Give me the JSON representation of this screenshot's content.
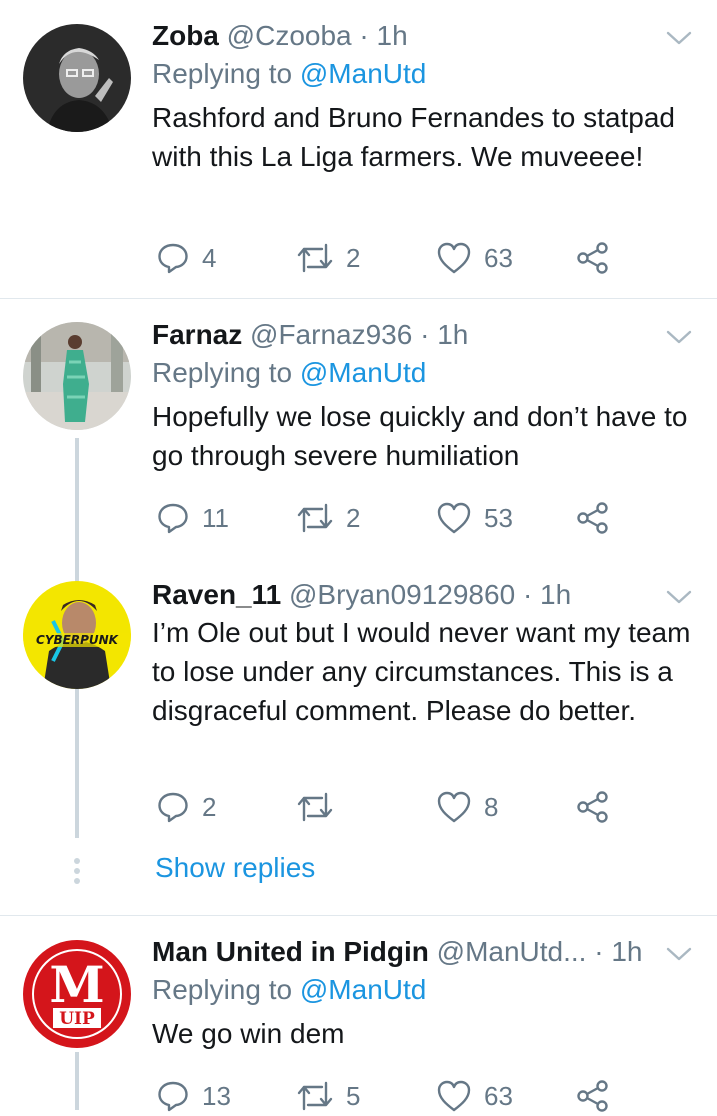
{
  "tweets": [
    {
      "name": "Zoba",
      "handle": "@Czooba",
      "dot": "·",
      "time": "1h",
      "replying_prefix": "Replying to ",
      "replying_to": "@ManUtd",
      "text": "Rashford and Bruno Fernandes to statpad with this La Liga farmers. We muveeee!",
      "replies": "4",
      "retweets": "2",
      "likes": "63"
    },
    {
      "name": "Farnaz",
      "handle": "@Farnaz936",
      "dot": "·",
      "time": "1h",
      "replying_prefix": "Replying to ",
      "replying_to": "@ManUtd",
      "text": "Hopefully we lose quickly and don’t have to go through severe humiliation",
      "replies": "11",
      "retweets": "2",
      "likes": "53"
    },
    {
      "name": "Raven_11",
      "handle": "@Bryan09129860",
      "dot": "·",
      "time": "1h",
      "text": "I’m Ole out but I would never want my team to lose under any circumstances. This is a disgraceful comment. Please do better.",
      "replies": "2",
      "retweets": "",
      "likes": "8",
      "avatar_text": "CYBERPUNK"
    },
    {
      "name": "Man United in Pidgin",
      "handle": "@ManUtd...",
      "dot": "·",
      "time": "1h",
      "replying_prefix": "Replying to ",
      "replying_to": "@ManUtd",
      "text": "We go win dem",
      "replies": "13",
      "retweets": "5",
      "likes": "63",
      "avatar_letter": "M",
      "avatar_text": "UIP"
    }
  ],
  "show_replies": "Show replies",
  "icons": [
    "reply-icon",
    "retweet-icon",
    "like-icon",
    "share-icon",
    "chevron-down-icon"
  ],
  "colors": {
    "link": "#1b95e0",
    "muted": "#657786",
    "text": "#14171a",
    "divider": "#e1e8ed"
  }
}
